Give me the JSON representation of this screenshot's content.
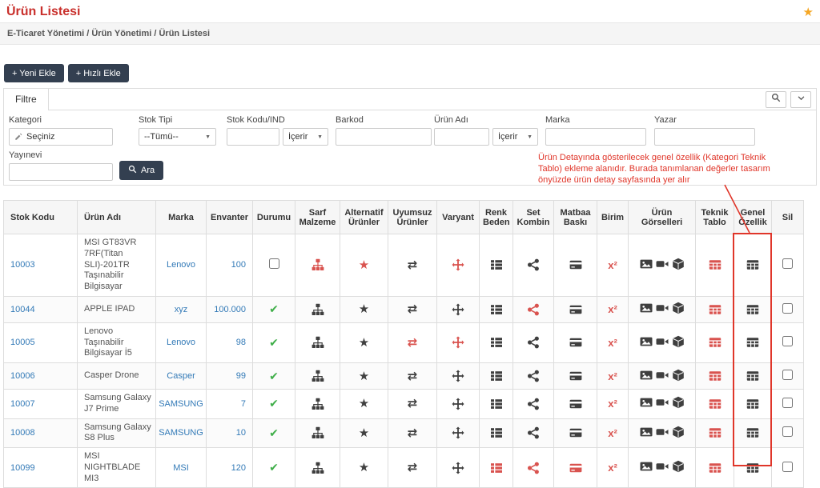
{
  "page": {
    "title": "Ürün Listesi",
    "breadcrumb": "E-Ticaret Yönetimi / Ürün Yönetimi / Ürün Listesi"
  },
  "toolbar": {
    "yeni_ekle_label": "+ Yeni Ekle",
    "hizli_ekle_label": "+ Hızlı Ekle"
  },
  "filter": {
    "tab_label": "Filtre",
    "kategori_label": "Kategori",
    "kategori_value": "Seçiniz",
    "stok_tipi_label": "Stok Tipi",
    "stok_tipi_value": "--Tümü--",
    "stok_kodu_label": "Stok Kodu/IND",
    "stok_kodu_operator": "İçerir",
    "barkod_label": "Barkod",
    "urun_adi_label": "Ürün Adı",
    "urun_adi_operator": "İçerir",
    "marka_label": "Marka",
    "yazar_label": "Yazar",
    "yayinevi_label": "Yayınevi",
    "ara_label": "Ara"
  },
  "annotation": {
    "text": "Ürün Detayında gösterilecek genel özellik (Kategori Teknik Tablo) ekleme alanıdır. Burada tanımlanan değerler tasarım önyüzde ürün detay sayfasında yer alır"
  },
  "icons": {
    "favorite_glyph": "★",
    "star_glyph": "★",
    "exchange_glyph": "⇄",
    "check_glyph": "✔",
    "caret_glyph": "▼",
    "x2_label": "x²"
  },
  "table": {
    "headers": [
      "Stok Kodu",
      "Ürün Adı",
      "Marka",
      "Envanter",
      "Durumu",
      "Sarf Malzeme",
      "Alternatif Ürünler",
      "Uyumsuz Ürünler",
      "Varyant",
      "Renk Beden",
      "Set Kombin",
      "Matbaa Baskı",
      "Birim",
      "Ürün Görselleri",
      "Teknik Tablo",
      "Genel Özellik",
      "Sil"
    ],
    "rows": [
      {
        "stok_kodu": "10003",
        "urun_adi": "MSI GT83VR 7RF(Titan SLI)-201TR Taşınabilir Bilgisayar",
        "marka": "Lenovo",
        "envanter": "100",
        "durumu": "unchecked",
        "icon_states": {
          "sarf_malzeme": "red",
          "alternatif_urunler": "red",
          "uyumsuz_urunler": "dark",
          "varyant": "red",
          "renk_beden": "dark",
          "set_kombin": "dark",
          "matbaa_baski": "dark",
          "birim": "red",
          "teknik_tablo": "red",
          "genel_ozellik": "dark"
        }
      },
      {
        "stok_kodu": "10044",
        "urun_adi": "APPLE IPAD",
        "marka": "xyz",
        "envanter": "100.000",
        "durumu": "checked",
        "icon_states": {
          "sarf_malzeme": "dark",
          "alternatif_urunler": "dark",
          "uyumsuz_urunler": "dark",
          "varyant": "dark",
          "renk_beden": "dark",
          "set_kombin": "red",
          "matbaa_baski": "dark",
          "birim": "red",
          "teknik_tablo": "red",
          "genel_ozellik": "dark"
        }
      },
      {
        "stok_kodu": "10005",
        "urun_adi": "Lenovo Taşınabilir Bilgisayar İ5",
        "marka": "Lenovo",
        "envanter": "98",
        "durumu": "checked",
        "icon_states": {
          "sarf_malzeme": "dark",
          "alternatif_urunler": "dark",
          "uyumsuz_urunler": "red",
          "varyant": "red",
          "renk_beden": "dark",
          "set_kombin": "dark",
          "matbaa_baski": "dark",
          "birim": "red",
          "teknik_tablo": "red",
          "genel_ozellik": "dark"
        }
      },
      {
        "stok_kodu": "10006",
        "urun_adi": "Casper Drone",
        "marka": "Casper",
        "envanter": "99",
        "durumu": "checked",
        "icon_states": {
          "sarf_malzeme": "dark",
          "alternatif_urunler": "dark",
          "uyumsuz_urunler": "dark",
          "varyant": "dark",
          "renk_beden": "dark",
          "set_kombin": "dark",
          "matbaa_baski": "dark",
          "birim": "red",
          "teknik_tablo": "red",
          "genel_ozellik": "dark"
        }
      },
      {
        "stok_kodu": "10007",
        "urun_adi": "Samsung Galaxy J7 Prime",
        "marka": "SAMSUNG",
        "envanter": "7",
        "durumu": "checked",
        "icon_states": {
          "sarf_malzeme": "dark",
          "alternatif_urunler": "dark",
          "uyumsuz_urunler": "dark",
          "varyant": "dark",
          "renk_beden": "dark",
          "set_kombin": "dark",
          "matbaa_baski": "dark",
          "birim": "red",
          "teknik_tablo": "red",
          "genel_ozellik": "dark"
        }
      },
      {
        "stok_kodu": "10008",
        "urun_adi": "Samsung Galaxy S8 Plus",
        "marka": "SAMSUNG",
        "envanter": "10",
        "durumu": "checked",
        "icon_states": {
          "sarf_malzeme": "dark",
          "alternatif_urunler": "dark",
          "uyumsuz_urunler": "dark",
          "varyant": "dark",
          "renk_beden": "dark",
          "set_kombin": "dark",
          "matbaa_baski": "dark",
          "birim": "red",
          "teknik_tablo": "red",
          "genel_ozellik": "dark"
        }
      },
      {
        "stok_kodu": "10099",
        "urun_adi": "MSI NIGHTBLADE MI3",
        "marka": "MSI",
        "envanter": "120",
        "durumu": "checked",
        "icon_states": {
          "sarf_malzeme": "dark",
          "alternatif_urunler": "dark",
          "uyumsuz_urunler": "dark",
          "varyant": "dark",
          "renk_beden": "red",
          "set_kombin": "red",
          "matbaa_baski": "red",
          "birim": "red",
          "teknik_tablo": "red",
          "genel_ozellik": "dark"
        }
      }
    ]
  },
  "colors": {
    "title_red": "#c9302c",
    "annotation_red": "#e0362a",
    "link_blue": "#337ab7",
    "check_green": "#3fae49",
    "button_dark": "#333f50",
    "star_orange": "#f5a623",
    "icon_dark": "#3f3f3f",
    "icon_red": "#d9534f"
  }
}
